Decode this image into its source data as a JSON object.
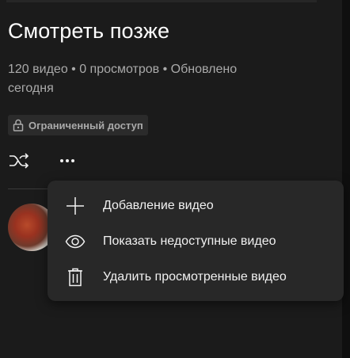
{
  "playlist": {
    "title": "Смотреть позже",
    "meta": "120 видео • 0 просмотров • Обновлено сегодня",
    "privacy_badge": "Ограниченный доступ"
  },
  "menu": {
    "items": [
      {
        "label": "Добавление видео",
        "icon": "plus-icon"
      },
      {
        "label": "Показать недоступные видео",
        "icon": "eye-icon"
      },
      {
        "label": "Удалить просмотренные видео",
        "icon": "trash-icon"
      }
    ]
  }
}
